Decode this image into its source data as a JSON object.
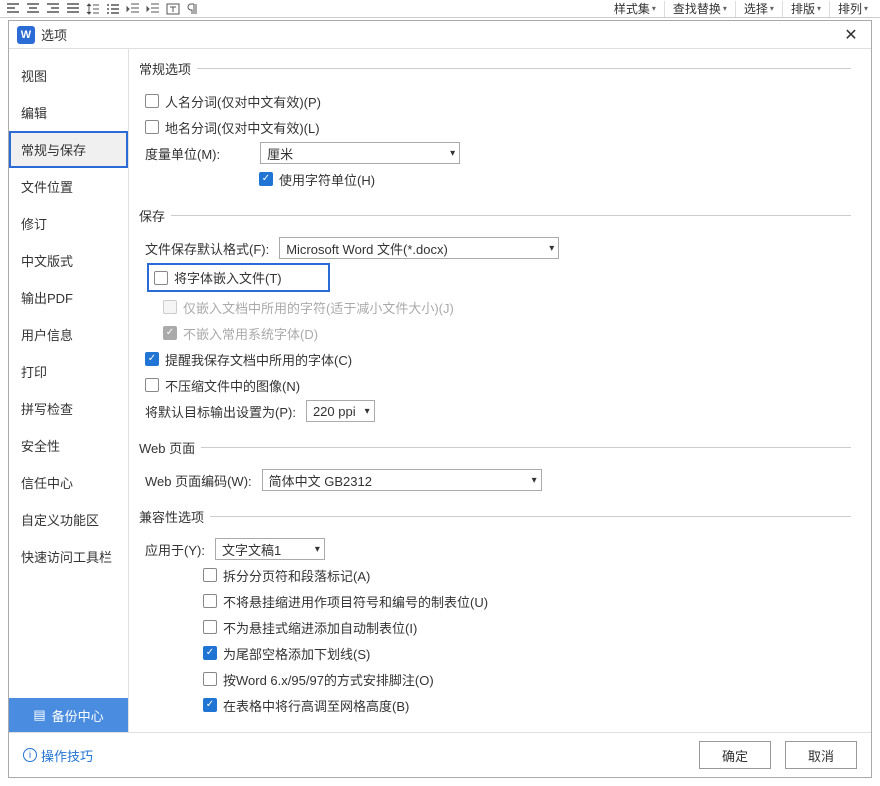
{
  "toolbar_right": [
    {
      "label": "样式集",
      "name": "tb-styles"
    },
    {
      "label": "查找替换",
      "name": "tb-findreplace"
    },
    {
      "label": "选择",
      "name": "tb-select"
    },
    {
      "label": "排版",
      "name": "tb-typeset"
    },
    {
      "label": "排列",
      "name": "tb-arrange"
    }
  ],
  "dialog": {
    "title": "选项",
    "close": "✕",
    "sidebar": [
      {
        "label": "视图",
        "name": "side-view"
      },
      {
        "label": "编辑",
        "name": "side-edit"
      },
      {
        "label": "常规与保存",
        "name": "side-general-save",
        "active": true
      },
      {
        "label": "文件位置",
        "name": "side-filelocation"
      },
      {
        "label": "修订",
        "name": "side-revision"
      },
      {
        "label": "中文版式",
        "name": "side-chinese"
      },
      {
        "label": "输出PDF",
        "name": "side-pdf"
      },
      {
        "label": "用户信息",
        "name": "side-userinfo"
      },
      {
        "label": "打印",
        "name": "side-print"
      },
      {
        "label": "拼写检查",
        "name": "side-spell"
      },
      {
        "label": "安全性",
        "name": "side-security"
      },
      {
        "label": "信任中心",
        "name": "side-trust"
      },
      {
        "label": "自定义功能区",
        "name": "side-ribbon"
      },
      {
        "label": "快速访问工具栏",
        "name": "side-qat"
      }
    ],
    "backup": "备份中心",
    "sections": {
      "general": {
        "legend": "常规选项",
        "name_seg": "人名分词(仅对中文有效)(P)",
        "place_seg": "地名分词(仅对中文有效)(L)",
        "unit_label": "度量单位(M):",
        "unit_value": "厘米",
        "use_char_unit": "使用字符单位(H)"
      },
      "save": {
        "legend": "保存",
        "default_fmt_label": "文件保存默认格式(F):",
        "default_fmt_value": "Microsoft Word 文件(*.docx)",
        "embed_font": "将字体嵌入文件(T)",
        "embed_used_only": "仅嵌入文档中所用的字符(适于减小文件大小)(J)",
        "no_sys_font": "不嵌入常用系统字体(D)",
        "remind_fonts": "提醒我保存文档中所用的字体(C)",
        "no_compress_img": "不压缩文件中的图像(N)",
        "default_res_label": "将默认目标输出设置为(P):",
        "default_res_value": "220 ppi"
      },
      "web": {
        "legend": "Web 页面",
        "encoding_label": "Web 页面编码(W):",
        "encoding_value": "简体中文 GB2312"
      },
      "compat": {
        "legend": "兼容性选项",
        "apply_label": "应用于(Y):",
        "apply_value": "文字文稿1",
        "split_page": "拆分分页符和段落标记(A)",
        "no_hang_tab": "不将悬挂缩进用作项目符号和编号的制表位(U)",
        "no_auto_tab": "不为悬挂式缩进添加自动制表位(I)",
        "trail_ul": "为尾部空格添加下划线(S)",
        "word6": "按Word 6.x/95/97的方式安排脚注(O)",
        "table_grid": "在表格中将行高调至网格高度(B)"
      }
    },
    "tips": "操作技巧",
    "ok": "确定",
    "cancel": "取消"
  }
}
